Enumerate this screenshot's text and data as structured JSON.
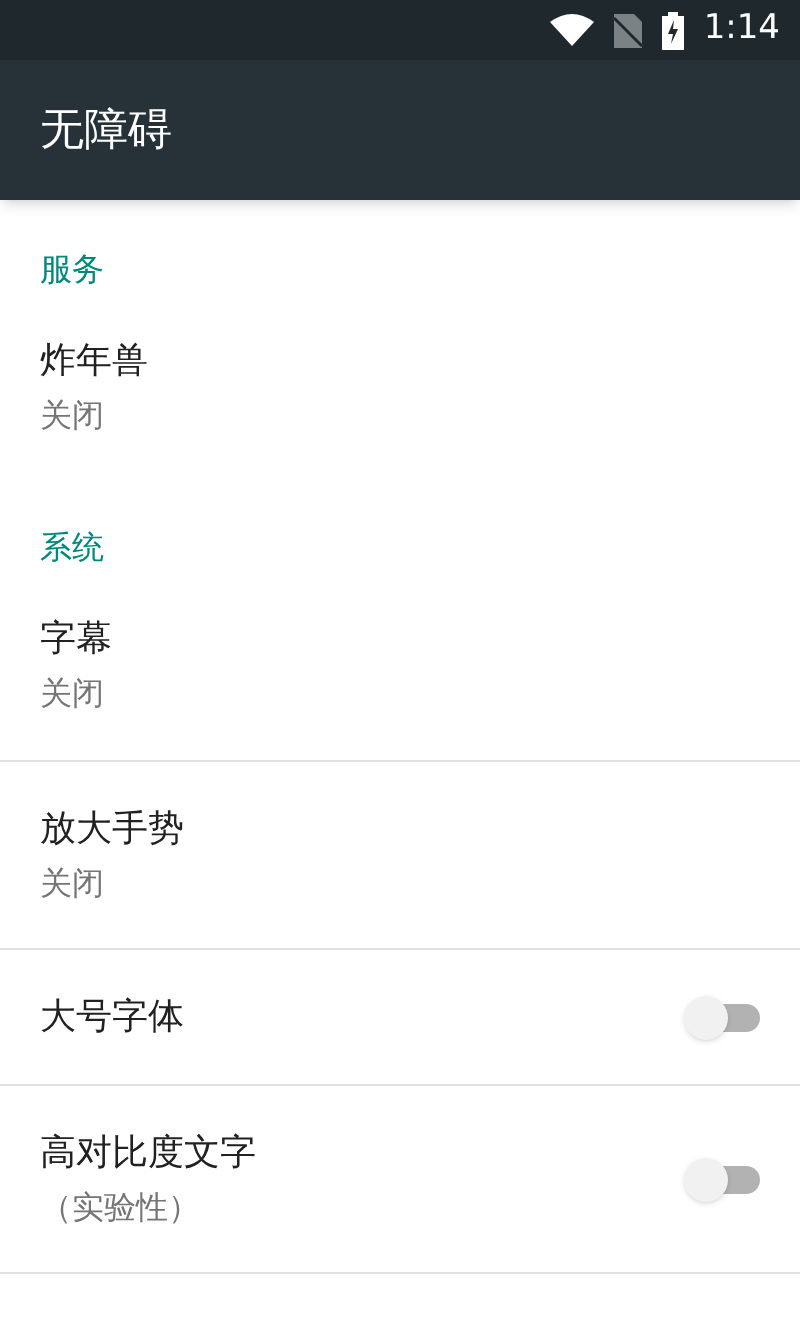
{
  "status_bar": {
    "time": "1:14"
  },
  "app_bar": {
    "title": "无障碍"
  },
  "sections": [
    {
      "header": "服务",
      "items": [
        {
          "kind": "text",
          "title": "炸年兽",
          "summary": "关闭"
        }
      ]
    },
    {
      "header": "系统",
      "items": [
        {
          "kind": "text",
          "title": "字幕",
          "summary": "关闭"
        },
        {
          "kind": "text",
          "title": "放大手势",
          "summary": "关闭"
        },
        {
          "kind": "switch",
          "title": "大号字体",
          "on": false
        },
        {
          "kind": "switch",
          "title": "高对比度文字",
          "summary": "（实验性）",
          "on": false
        }
      ]
    }
  ]
}
